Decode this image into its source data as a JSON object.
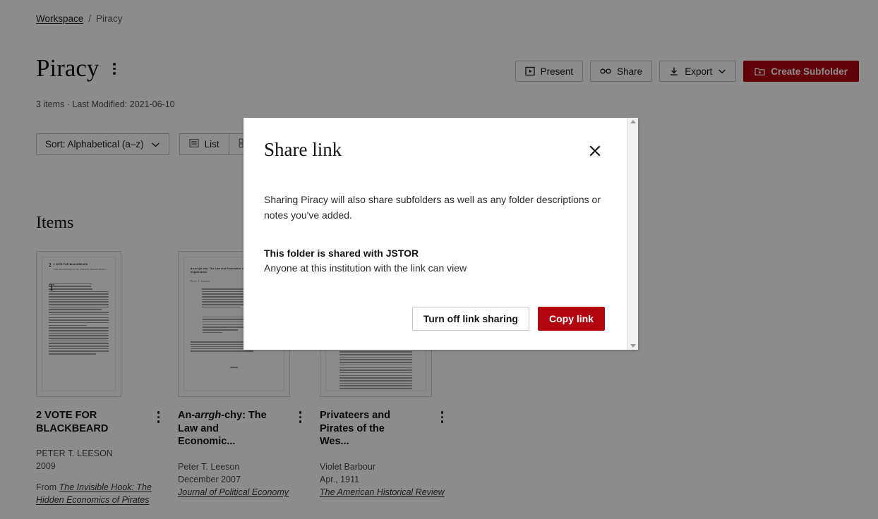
{
  "breadcrumb": {
    "root": "Workspace",
    "separator": "/",
    "current": "Piracy"
  },
  "header": {
    "title": "Piracy",
    "menu_icon": "kebab-menu-icon",
    "meta": "3 items · Last Modified: 2021-06-10"
  },
  "actions": {
    "present": "Present",
    "share": "Share",
    "export": "Export",
    "create_subfolder": "Create Subfolder"
  },
  "toolbar": {
    "sort": "Sort: Alphabetical (a–z)",
    "list": "List",
    "grid": ""
  },
  "items_section": {
    "heading": "Items"
  },
  "cards": [
    {
      "title_prefix": "2 VOTE FOR BLACKBEARD",
      "title_html": "2 VOTE FOR BLACKBEARD",
      "author": "PETER T. LEESON",
      "date": "2009",
      "source_prefix": "From ",
      "source": "The Invisible Hook: The Hidden Economics of Pirates",
      "thumb_head": "2 VOTE FOR BLACKBEARD",
      "thumb_sub": "THE ECONOMICS OF PIRATE DEMOCRACY"
    },
    {
      "title_prefix": "An-arrgh-chy: The Law and Economic...",
      "title_html": "An-<em>arrgh</em>-chy: The Law and Economic...",
      "author": "Peter T. Leeson",
      "date": "December 2007",
      "source_prefix": "",
      "source": "Journal of Political Economy",
      "thumb_head": "An-arrgh-chy: The Law and Economics of Pirate Organization",
      "thumb_sub": "Peter T. Leeson"
    },
    {
      "title_prefix": "Privateers and Pirates of the Wes...",
      "title_html": "Privateers and Pirates of the Wes...",
      "author": "Violet Barbour",
      "date": "Apr., 1911",
      "source_prefix": "",
      "source": "The American Historical Review",
      "thumb_head": "",
      "thumb_sub": ""
    }
  ],
  "modal": {
    "title": "Share link",
    "close_icon": "close-icon",
    "paragraph": "Sharing Piracy will also share subfolders as well as any folder descriptions or notes you've added.",
    "status_title": "This folder is shared with JSTOR",
    "status_sub": "Anyone at this institution with the link can view",
    "btn_turn_off": "Turn off link sharing",
    "btn_copy": "Copy link"
  },
  "colors": {
    "brand_red": "#b30510",
    "overlay": "rgba(0,0,0,0.45)",
    "border": "#c3c3c3",
    "text": "#111111"
  }
}
